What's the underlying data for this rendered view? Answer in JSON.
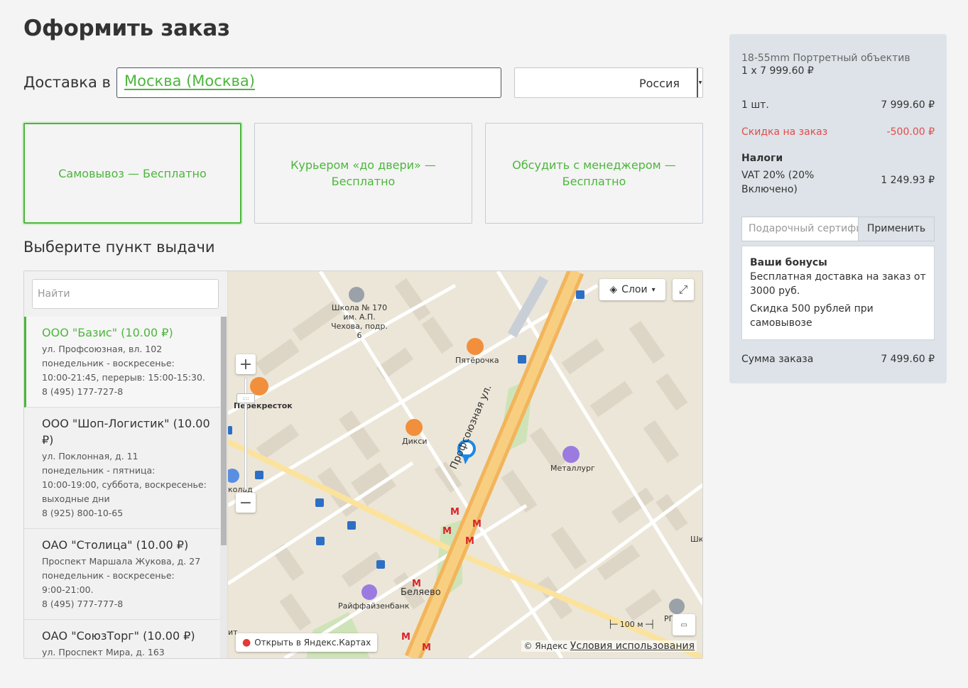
{
  "page_title": "Оформить заказ",
  "delivery": {
    "label": "Доставка в",
    "city": "Москва (Москва)",
    "country": "Россия"
  },
  "methods": [
    {
      "label": "Самовывоз — Бесплатно",
      "active": true
    },
    {
      "label": "Курьером «до двери» — Бесплатно",
      "active": false
    },
    {
      "label": "Обсудить с менеджером — Бесплатно",
      "active": false
    }
  ],
  "pickup": {
    "title": "Выберите пункт выдачи",
    "search_placeholder": "Найти",
    "points": [
      {
        "name": "ООО \"Базис\" (10.00 ₽)",
        "lines": [
          "ул. Профсоюзная, вл. 102",
          "понедельник - воскресенье:",
          "10:00-21:45, перерыв: 15:00-15:30.",
          "8 (495) 177-727-8"
        ]
      },
      {
        "name": "ООО \"Шоп-Логистик\" (10.00 ₽)",
        "lines": [
          "ул. Поклонная, д. 11",
          "понедельник - пятница:",
          "10:00-19:00, суббота, воскресенье:",
          "выходные дни",
          "8 (925) 800-10-65"
        ]
      },
      {
        "name": "ОАО \"Столица\" (10.00 ₽)",
        "lines": [
          "Проспект Маршала Жукова, д. 27",
          "понедельник - воскресенье:",
          "9:00-21:00.",
          "8 (495) 777-777-8"
        ]
      },
      {
        "name": "ОАО \"СоюзТорг\" (10.00 ₽)",
        "lines": [
          "ул. Проспект Мира, д. 163"
        ]
      }
    ]
  },
  "map": {
    "layers_label": "Слои",
    "open_label": "Открыть в Яндекс.Картах",
    "copyright": "© Яндекс",
    "terms": "Условия использования",
    "scale": "100 м",
    "labels": {
      "school": "Школа № 170 им. А.П. Чехова, подр. 6",
      "pyaterochka": "Пятёрочка",
      "perekrestok": "Перекресток",
      "diksi": "Дикси",
      "street": "Профсоюзная ул.",
      "metallurg": "Металлург",
      "belyaevo": "Беляево",
      "raiffeisen": "Райффайзенбанк",
      "kolad": "колад",
      "shk": "Шк",
      "rg": "РГ",
      "it": "ит"
    }
  },
  "summary": {
    "product": "18-55mm Портретный объектив",
    "qty_price": "1 x 7 999.60 ₽",
    "count_label": "1 шт.",
    "count_value": "7 999.60 ₽",
    "discount_label": "Скидка на заказ",
    "discount_value": "-500.00 ₽",
    "tax_title": "Налоги",
    "tax_name": "VAT 20% (20% Включено)",
    "tax_value": "1 249.93 ₽",
    "coupon_placeholder": "Подарочный сертификат",
    "apply_label": "Применить",
    "bonus_title": "Ваши бонусы",
    "bonus_1": "Бесплатная доставка на заказ от 3000 руб.",
    "bonus_2": "Скидка 500 рублей при самовывозе",
    "total_label": "Сумма заказа",
    "total_value": "7 499.60 ₽"
  },
  "colors": {
    "accent": "#4cb63c",
    "discount": "#e24c4c",
    "sidebar_bg": "#dde3e8"
  }
}
